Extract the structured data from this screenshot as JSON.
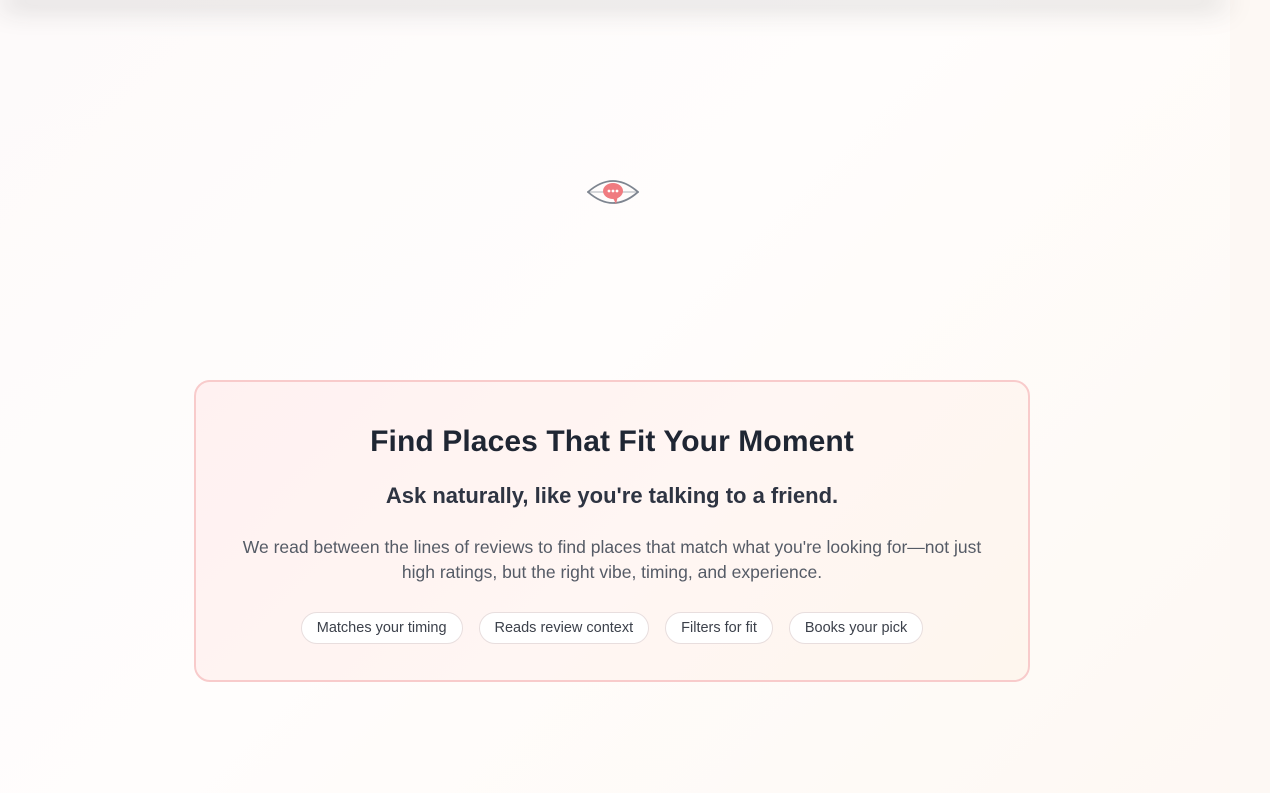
{
  "logo": {
    "icon": "eye-speech-bubble-icon",
    "accent_color": "#f07b80"
  },
  "card": {
    "title": "Find Places That Fit Your Moment",
    "subtitle": "Ask naturally, like you're talking to a friend.",
    "description": "We read between the lines of reviews to find places that match what you're looking for—not just high ratings, but the right vibe, timing, and experience.",
    "features": [
      {
        "label": "Matches your timing"
      },
      {
        "label": "Reads review context"
      },
      {
        "label": "Filters for fit"
      },
      {
        "label": "Books your pick"
      }
    ]
  }
}
